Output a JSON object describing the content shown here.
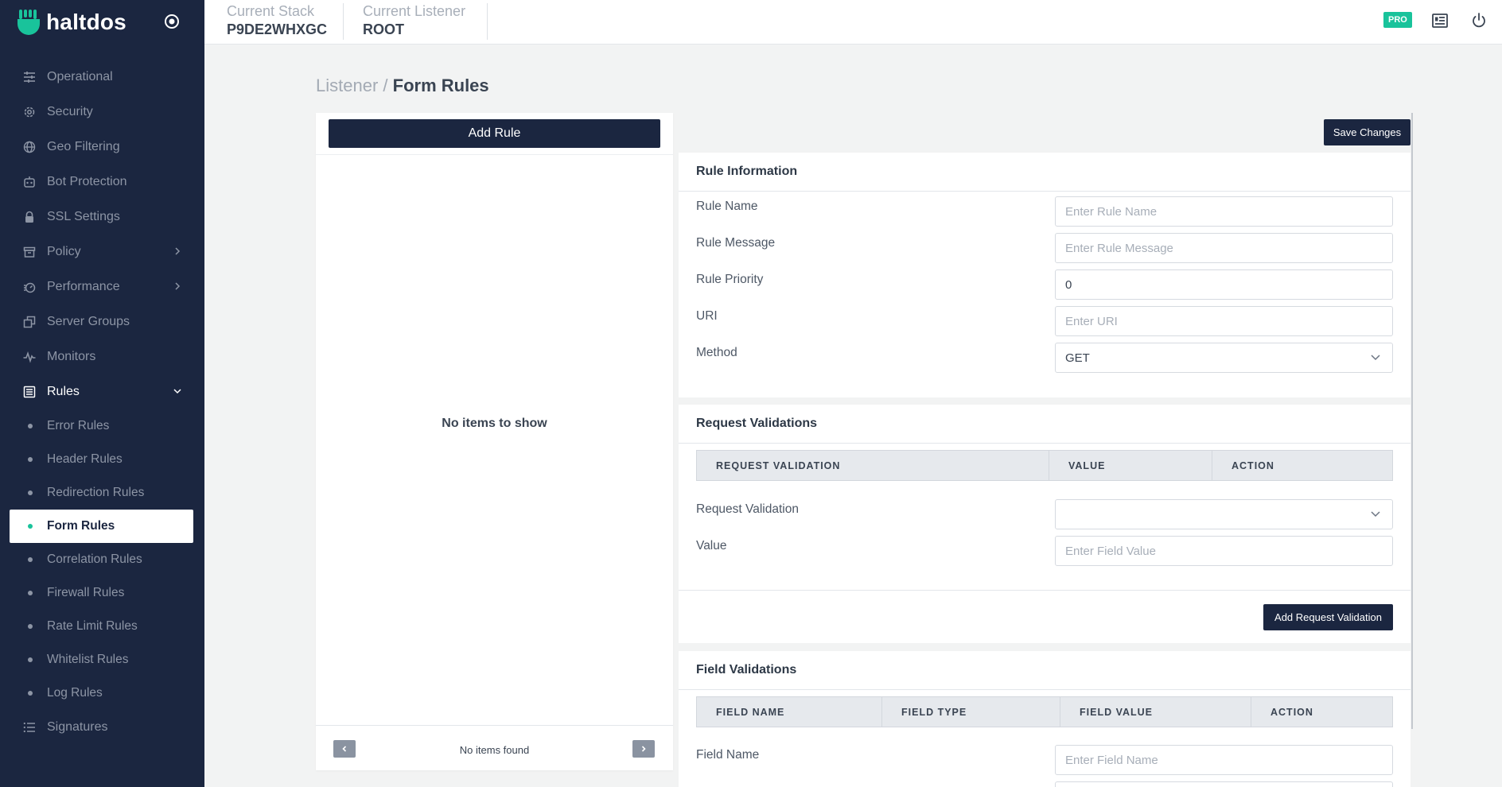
{
  "brand": {
    "name": "haltdos"
  },
  "topbar": {
    "stack_label": "Current Stack",
    "stack_value": "P9DE2WHXGC",
    "listener_label": "Current Listener",
    "listener_value": "ROOT",
    "pro_badge": "PRO"
  },
  "sidebar": {
    "items": [
      {
        "label": "Operational",
        "icon": "sliders-icon"
      },
      {
        "label": "Security",
        "icon": "gear-icon"
      },
      {
        "label": "Geo Filtering",
        "icon": "globe-icon"
      },
      {
        "label": "Bot Protection",
        "icon": "bot-icon"
      },
      {
        "label": "SSL Settings",
        "icon": "lock-icon"
      },
      {
        "label": "Policy",
        "icon": "archive-icon"
      },
      {
        "label": "Performance",
        "icon": "performance-icon"
      },
      {
        "label": "Server Groups",
        "icon": "copy-icon"
      },
      {
        "label": "Monitors",
        "icon": "pulse-icon"
      },
      {
        "label": "Rules",
        "icon": "list-box-icon"
      },
      {
        "label": "Signatures",
        "icon": "list-icon"
      }
    ],
    "rules_sub": [
      {
        "label": "Error Rules"
      },
      {
        "label": "Header Rules"
      },
      {
        "label": "Redirection Rules"
      },
      {
        "label": "Form Rules"
      },
      {
        "label": "Correlation Rules"
      },
      {
        "label": "Firewall Rules"
      },
      {
        "label": "Rate Limit Rules"
      },
      {
        "label": "Whitelist Rules"
      },
      {
        "label": "Log Rules"
      }
    ],
    "active_sub": "Form Rules"
  },
  "breadcrumb": {
    "parent": "Listener",
    "separator": " / ",
    "current": "Form Rules"
  },
  "left_panel": {
    "add_rule_label": "Add Rule",
    "empty_text": "No items to show",
    "pager_text": "No items found"
  },
  "save_changes_label": "Save Changes",
  "rule_information": {
    "title": "Rule Information",
    "rule_name_label": "Rule Name",
    "rule_name_placeholder": "Enter Rule Name",
    "rule_message_label": "Rule Message",
    "rule_message_placeholder": "Enter Rule Message",
    "rule_priority_label": "Rule Priority",
    "rule_priority_value": "0",
    "uri_label": "URI",
    "uri_placeholder": "Enter URI",
    "method_label": "Method",
    "method_value": "GET"
  },
  "request_validations": {
    "title": "Request Validations",
    "columns": [
      "REQUEST VALIDATION",
      "VALUE",
      "ACTION"
    ],
    "request_validation_label": "Request Validation",
    "request_validation_value": "",
    "value_label": "Value",
    "value_placeholder": "Enter Field Value",
    "add_button_label": "Add Request Validation"
  },
  "field_validations": {
    "title": "Field Validations",
    "columns": [
      "FIELD NAME",
      "FIELD TYPE",
      "FIELD VALUE",
      "ACTION"
    ],
    "field_name_label": "Field Name",
    "field_name_placeholder": "Enter Field Name"
  },
  "colors": {
    "sidebar_bg": "#1b2640",
    "accent": "#19c39b",
    "page_bg": "#f2f3f3"
  }
}
